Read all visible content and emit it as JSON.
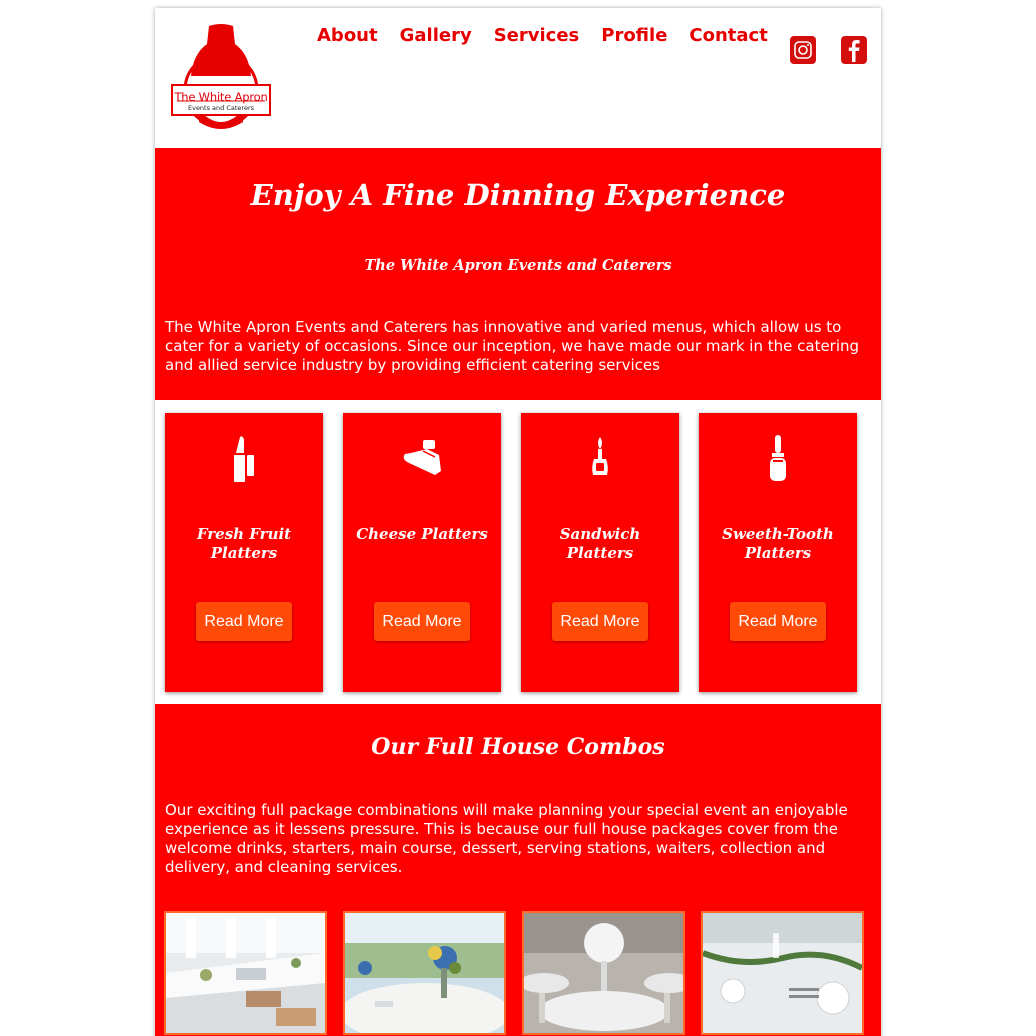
{
  "header": {
    "logo": {
      "line1": "The White Apron",
      "line2": "Events and Caterers"
    },
    "nav": [
      "About",
      "Gallery",
      "Services",
      "Profile",
      "Contact"
    ],
    "social": [
      {
        "name": "instagram-icon"
      },
      {
        "name": "facebook-icon"
      }
    ]
  },
  "hero": {
    "title": "Enjoy A Fine Dinning Experience",
    "subtitle": "The White Apron Events and Caterers",
    "text": "The White Apron Events and Caterers has innovative and varied menus, which allow us to cater for a variety of occasions. Since our inception, we have made our mark in the catering and allied service industry by providing efficient catering services"
  },
  "cards": [
    {
      "title": "Fresh Fruit Platters",
      "button": "Read More",
      "icon": "lipstick-icon"
    },
    {
      "title": "Cheese Platters",
      "button": "Read More",
      "icon": "bottle-icon"
    },
    {
      "title": "Sandwich Platters",
      "button": "Read More",
      "icon": "perfume-icon"
    },
    {
      "title": "Sweeth-Tooth Platters",
      "button": "Read More",
      "icon": "nail-polish-icon"
    }
  ],
  "combos": {
    "title": "Our Full House Combos",
    "text": "Our exciting full package combinations will make planning your special event an enjoyable experience as it lessens pressure. This is because our full house packages cover from the welcome drinks, starters, main course, dessert, serving stations, waiters, collection and delivery, and cleaning services."
  },
  "colors": {
    "primary": "#fe0000",
    "nav": "#e60000",
    "button": "#ff4a08",
    "white": "#ffffff"
  }
}
